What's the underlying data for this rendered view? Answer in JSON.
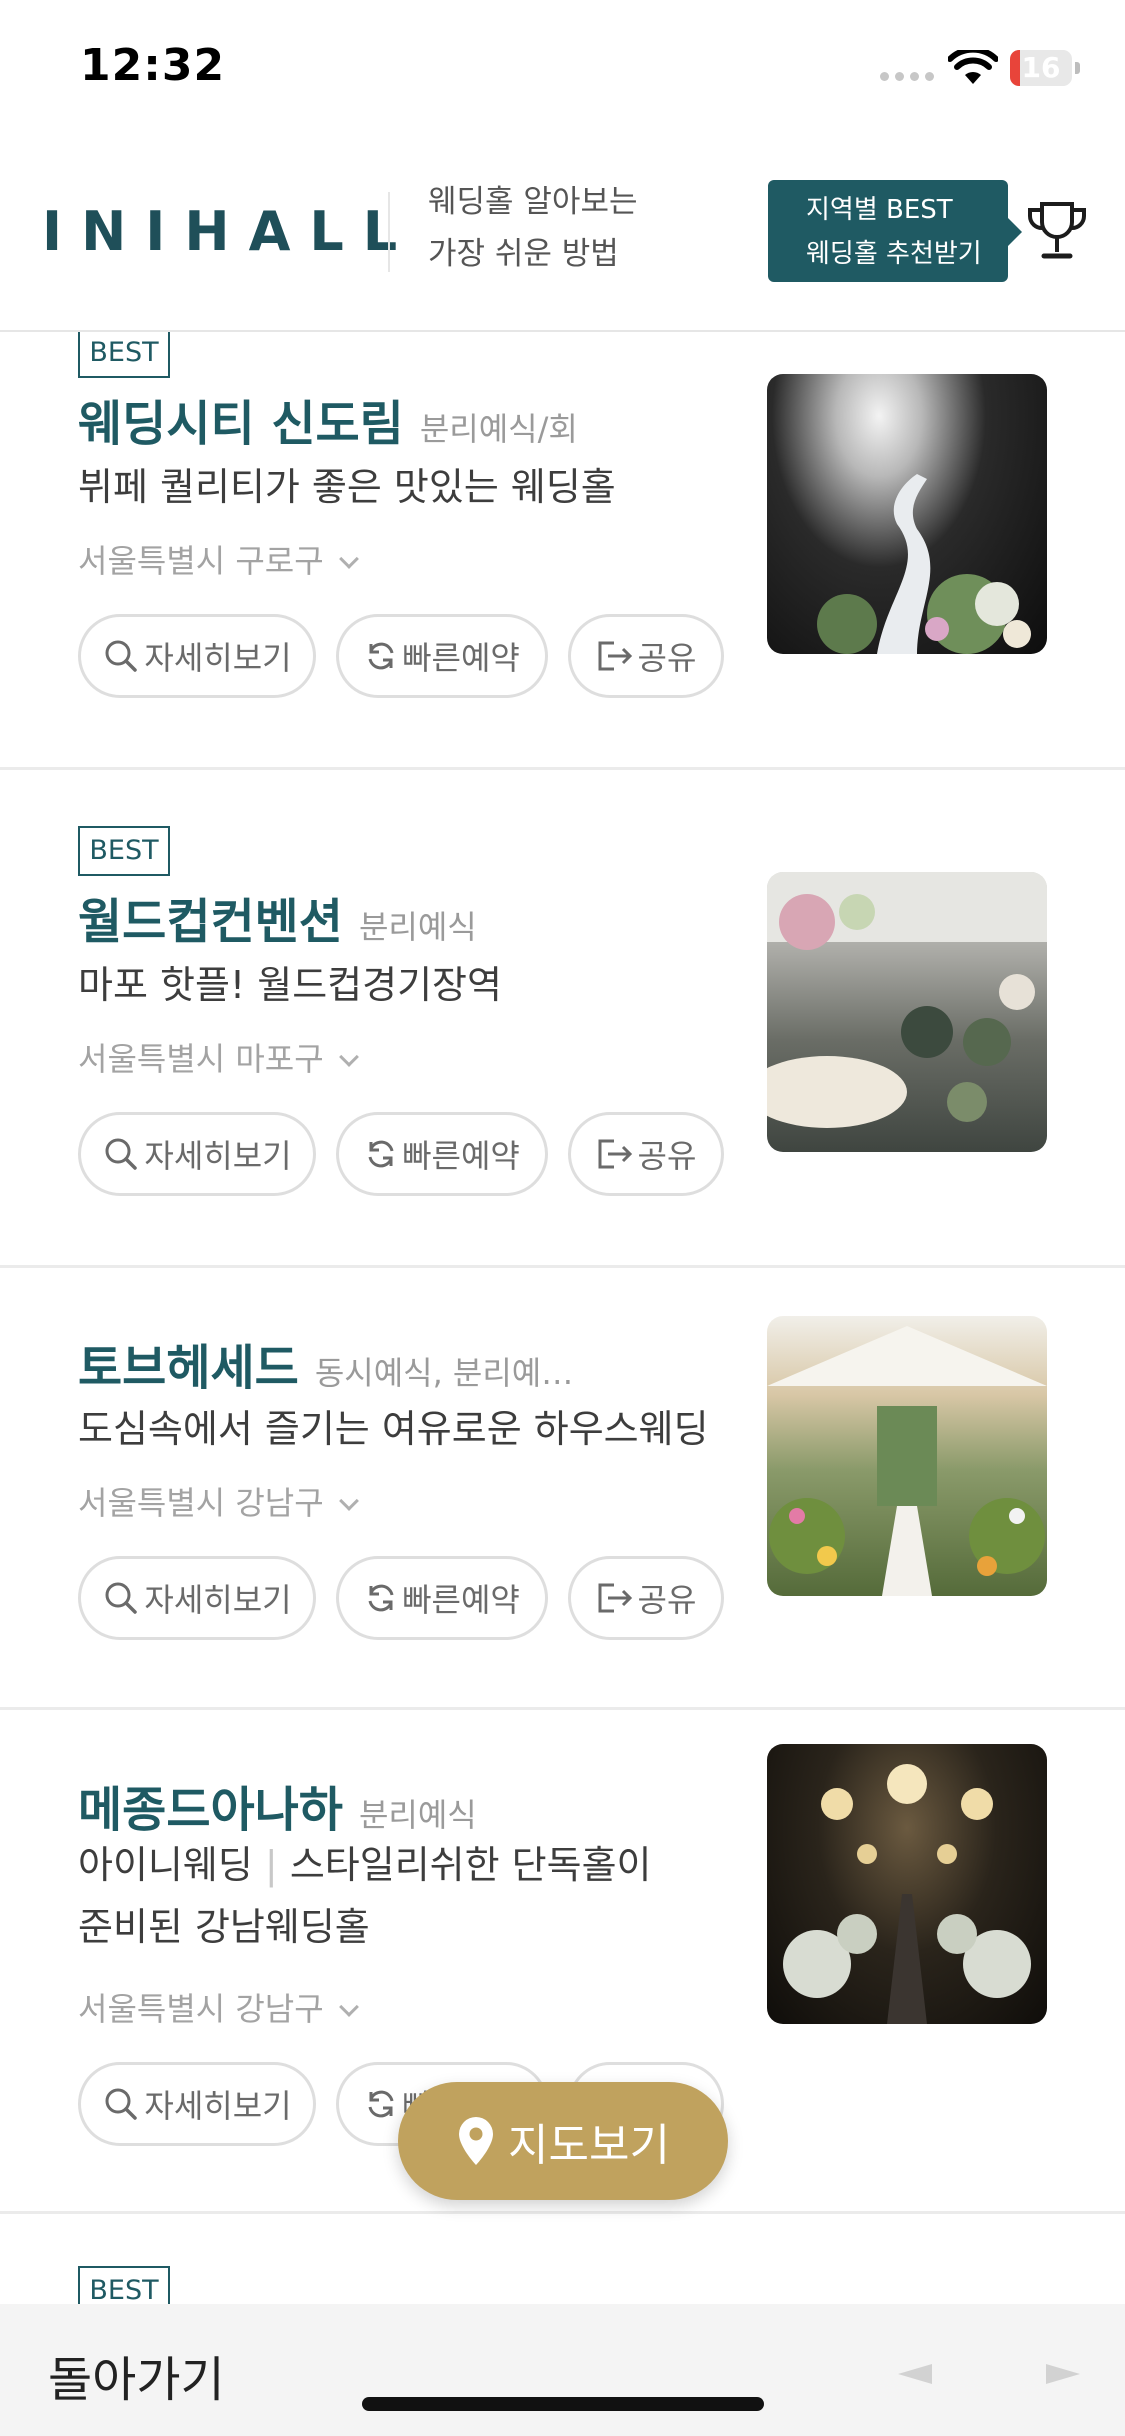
{
  "status_bar": {
    "time": "12:32",
    "battery": "16",
    "battery_level": 0.16
  },
  "header": {
    "logo": "INIHALL",
    "tagline_line1": "웨딩홀 알아보는",
    "tagline_line2": "가장 쉬운 방법",
    "best_button_line1": "지역별 BEST",
    "best_button_line2": "웨딩홀 추천받기"
  },
  "labels": {
    "best_badge": "BEST",
    "detail_button": "자세히보기",
    "quick_reserve_button": "빠른예약",
    "share_button": "공유"
  },
  "listings": [
    {
      "best": true,
      "name": "웨딩시티 신도림",
      "type": "분리예식/회",
      "desc_line1": "뷔페 퀄리티가 좋은 맛있는 웨딩홀",
      "desc_line2": "",
      "region": "서울특별시 구로구"
    },
    {
      "best": true,
      "name": "월드컵컨벤션",
      "type": "분리예식",
      "desc_line1": "마포 핫플! 월드컵경기장역",
      "desc_line2": "",
      "region": "서울특별시 마포구"
    },
    {
      "best": false,
      "name": "토브헤세드",
      "type": "동시예식, 분리예…",
      "desc_line1": "도심속에서 즐기는 여유로운 하우스웨딩",
      "desc_line2": "",
      "region": "서울특별시 강남구"
    },
    {
      "best": false,
      "name": "메종드아나하",
      "type": "분리예식",
      "desc_line1a": "아이니웨딩",
      "desc_sep": "|",
      "desc_line1b": "스타일리쉬한 단독홀이",
      "desc_line2": "준비된 강남웨딩홀",
      "region": "서울특별시 강남구"
    }
  ],
  "map_button": "지도보기",
  "bottom_bar": {
    "back": "돌아가기"
  },
  "colors": {
    "brand_teal": "#1f5a63",
    "map_gold": "#c0a25e",
    "battery_red": "#e8443a"
  },
  "icons": [
    "wifi-icon",
    "trophy-icon",
    "search-icon",
    "refresh-icon",
    "share-icon",
    "map-pin-icon"
  ]
}
